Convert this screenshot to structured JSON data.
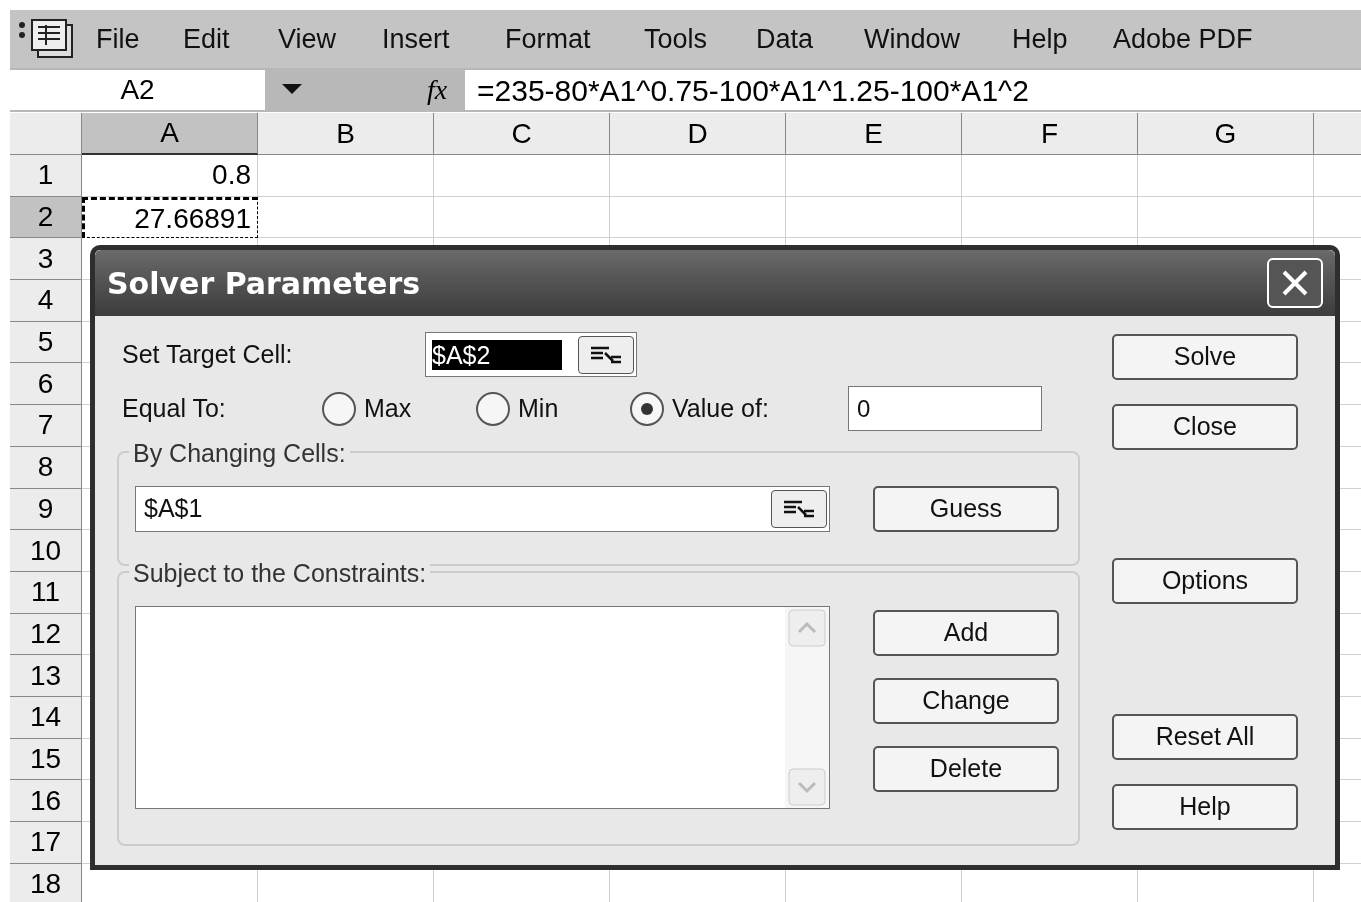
{
  "menu_bar": {
    "items": [
      "File",
      "Edit",
      "View",
      "Insert",
      "Format",
      "Tools",
      "Data",
      "Window",
      "Help",
      "Adobe PDF"
    ]
  },
  "formula_bar": {
    "name_box": "A2",
    "function_label": "fx",
    "formula": "=235-80*A1^0.75-100*A1^1.25-100*A1^2"
  },
  "sheet": {
    "columns": [
      {
        "label": "A",
        "selected": true
      },
      {
        "label": "B",
        "selected": false
      },
      {
        "label": "C",
        "selected": false
      },
      {
        "label": "D",
        "selected": false
      },
      {
        "label": "E",
        "selected": false
      },
      {
        "label": "F",
        "selected": false
      },
      {
        "label": "G",
        "selected": false
      }
    ],
    "rows": [
      {
        "label": "1",
        "selected": false,
        "column_a_value": "0.8",
        "copy_marquee": false
      },
      {
        "label": "2",
        "selected": true,
        "column_a_value": "27.66891",
        "copy_marquee": true
      },
      {
        "label": "3",
        "selected": false
      },
      {
        "label": "4",
        "selected": false
      },
      {
        "label": "5",
        "selected": false
      },
      {
        "label": "6",
        "selected": false
      },
      {
        "label": "7",
        "selected": false
      },
      {
        "label": "8",
        "selected": false
      },
      {
        "label": "9",
        "selected": false
      },
      {
        "label": "10",
        "selected": false
      },
      {
        "label": "11",
        "selected": false
      },
      {
        "label": "12",
        "selected": false
      },
      {
        "label": "13",
        "selected": false
      },
      {
        "label": "14",
        "selected": false
      },
      {
        "label": "15",
        "selected": false
      },
      {
        "label": "16",
        "selected": false
      },
      {
        "label": "17",
        "selected": false
      },
      {
        "label": "18",
        "selected": false
      }
    ]
  },
  "dialog": {
    "title": "Solver Parameters",
    "target_cell": {
      "label": "Set Target Cell:",
      "value": "$A$2"
    },
    "equal_to": {
      "label": "Equal To:",
      "options": [
        {
          "label": "Max",
          "selected": false
        },
        {
          "label": "Min",
          "selected": false
        },
        {
          "label": "Value of:",
          "selected": true
        }
      ],
      "value": "0"
    },
    "changing_cells": {
      "label": "By Changing Cells:",
      "value": "$A$1",
      "button": "Guess"
    },
    "constraints": {
      "label": "Subject to the Constraints:",
      "buttons": [
        "Add",
        "Change",
        "Delete"
      ]
    },
    "side_buttons": [
      "Solve",
      "Close",
      "Options",
      "Reset All",
      "Help"
    ]
  }
}
